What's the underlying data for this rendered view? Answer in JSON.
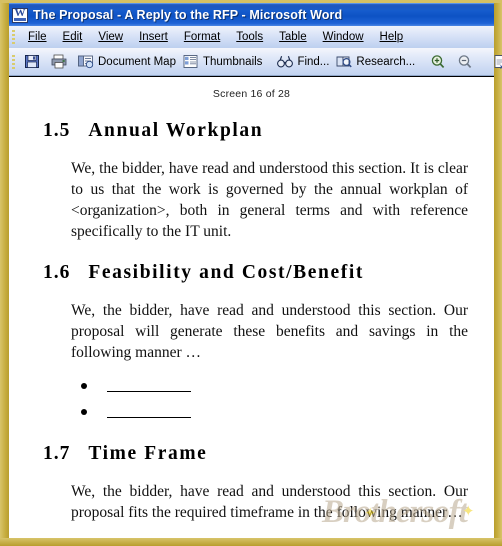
{
  "window": {
    "icon": "word-document-icon",
    "title": "The Proposal - A Reply to the RFP  - Microsoft Word"
  },
  "menubar": {
    "items": [
      {
        "label": "File",
        "accel": "F"
      },
      {
        "label": "Edit",
        "accel": "E"
      },
      {
        "label": "View",
        "accel": "V"
      },
      {
        "label": "Insert",
        "accel": "I"
      },
      {
        "label": "Format",
        "accel": "o"
      },
      {
        "label": "Tools",
        "accel": "T"
      },
      {
        "label": "Table",
        "accel": "a"
      },
      {
        "label": "Window",
        "accel": "W"
      },
      {
        "label": "Help",
        "accel": "H"
      }
    ]
  },
  "toolbar": {
    "save_label": "",
    "print_label": "",
    "document_map_label": "Document Map",
    "thumbnails_label": "Thumbnails",
    "find_label": "Find...",
    "research_label": "Research...",
    "increase_label": "",
    "decrease_label": "",
    "actual_page_label": "",
    "reading_layout_label": "",
    "close_label": ""
  },
  "document": {
    "screen_indicator": "Screen 16 of 28",
    "sections": [
      {
        "number": "1.5",
        "title": "Annual Workplan",
        "paragraph": "We, the bidder, have read and understood this section. It is clear to us that the work is governed by the annual workplan of <organization>, both in general terms and with reference specifically to the IT unit."
      },
      {
        "number": "1.6",
        "title": "Feasibility and Cost/Benefit",
        "paragraph": "We, the bidder, have read and understood this section. Our proposal will generate these benefits and savings in the following manner …",
        "bullets": [
          "",
          ""
        ]
      },
      {
        "number": "1.7",
        "title": "Time Frame",
        "paragraph": "We, the bidder, have read and understood this section. Our proposal fits the required timeframe in the following manner…"
      }
    ]
  },
  "watermark": {
    "text": "Brothersoft"
  },
  "colors": {
    "title_bar": "#1056c6",
    "frame": "#c9b24a",
    "menu_bar": "#cfdcf4",
    "toolbar": "#dbe6f8",
    "page": "#ffffff",
    "pressed_button": "#f0bf7c"
  }
}
